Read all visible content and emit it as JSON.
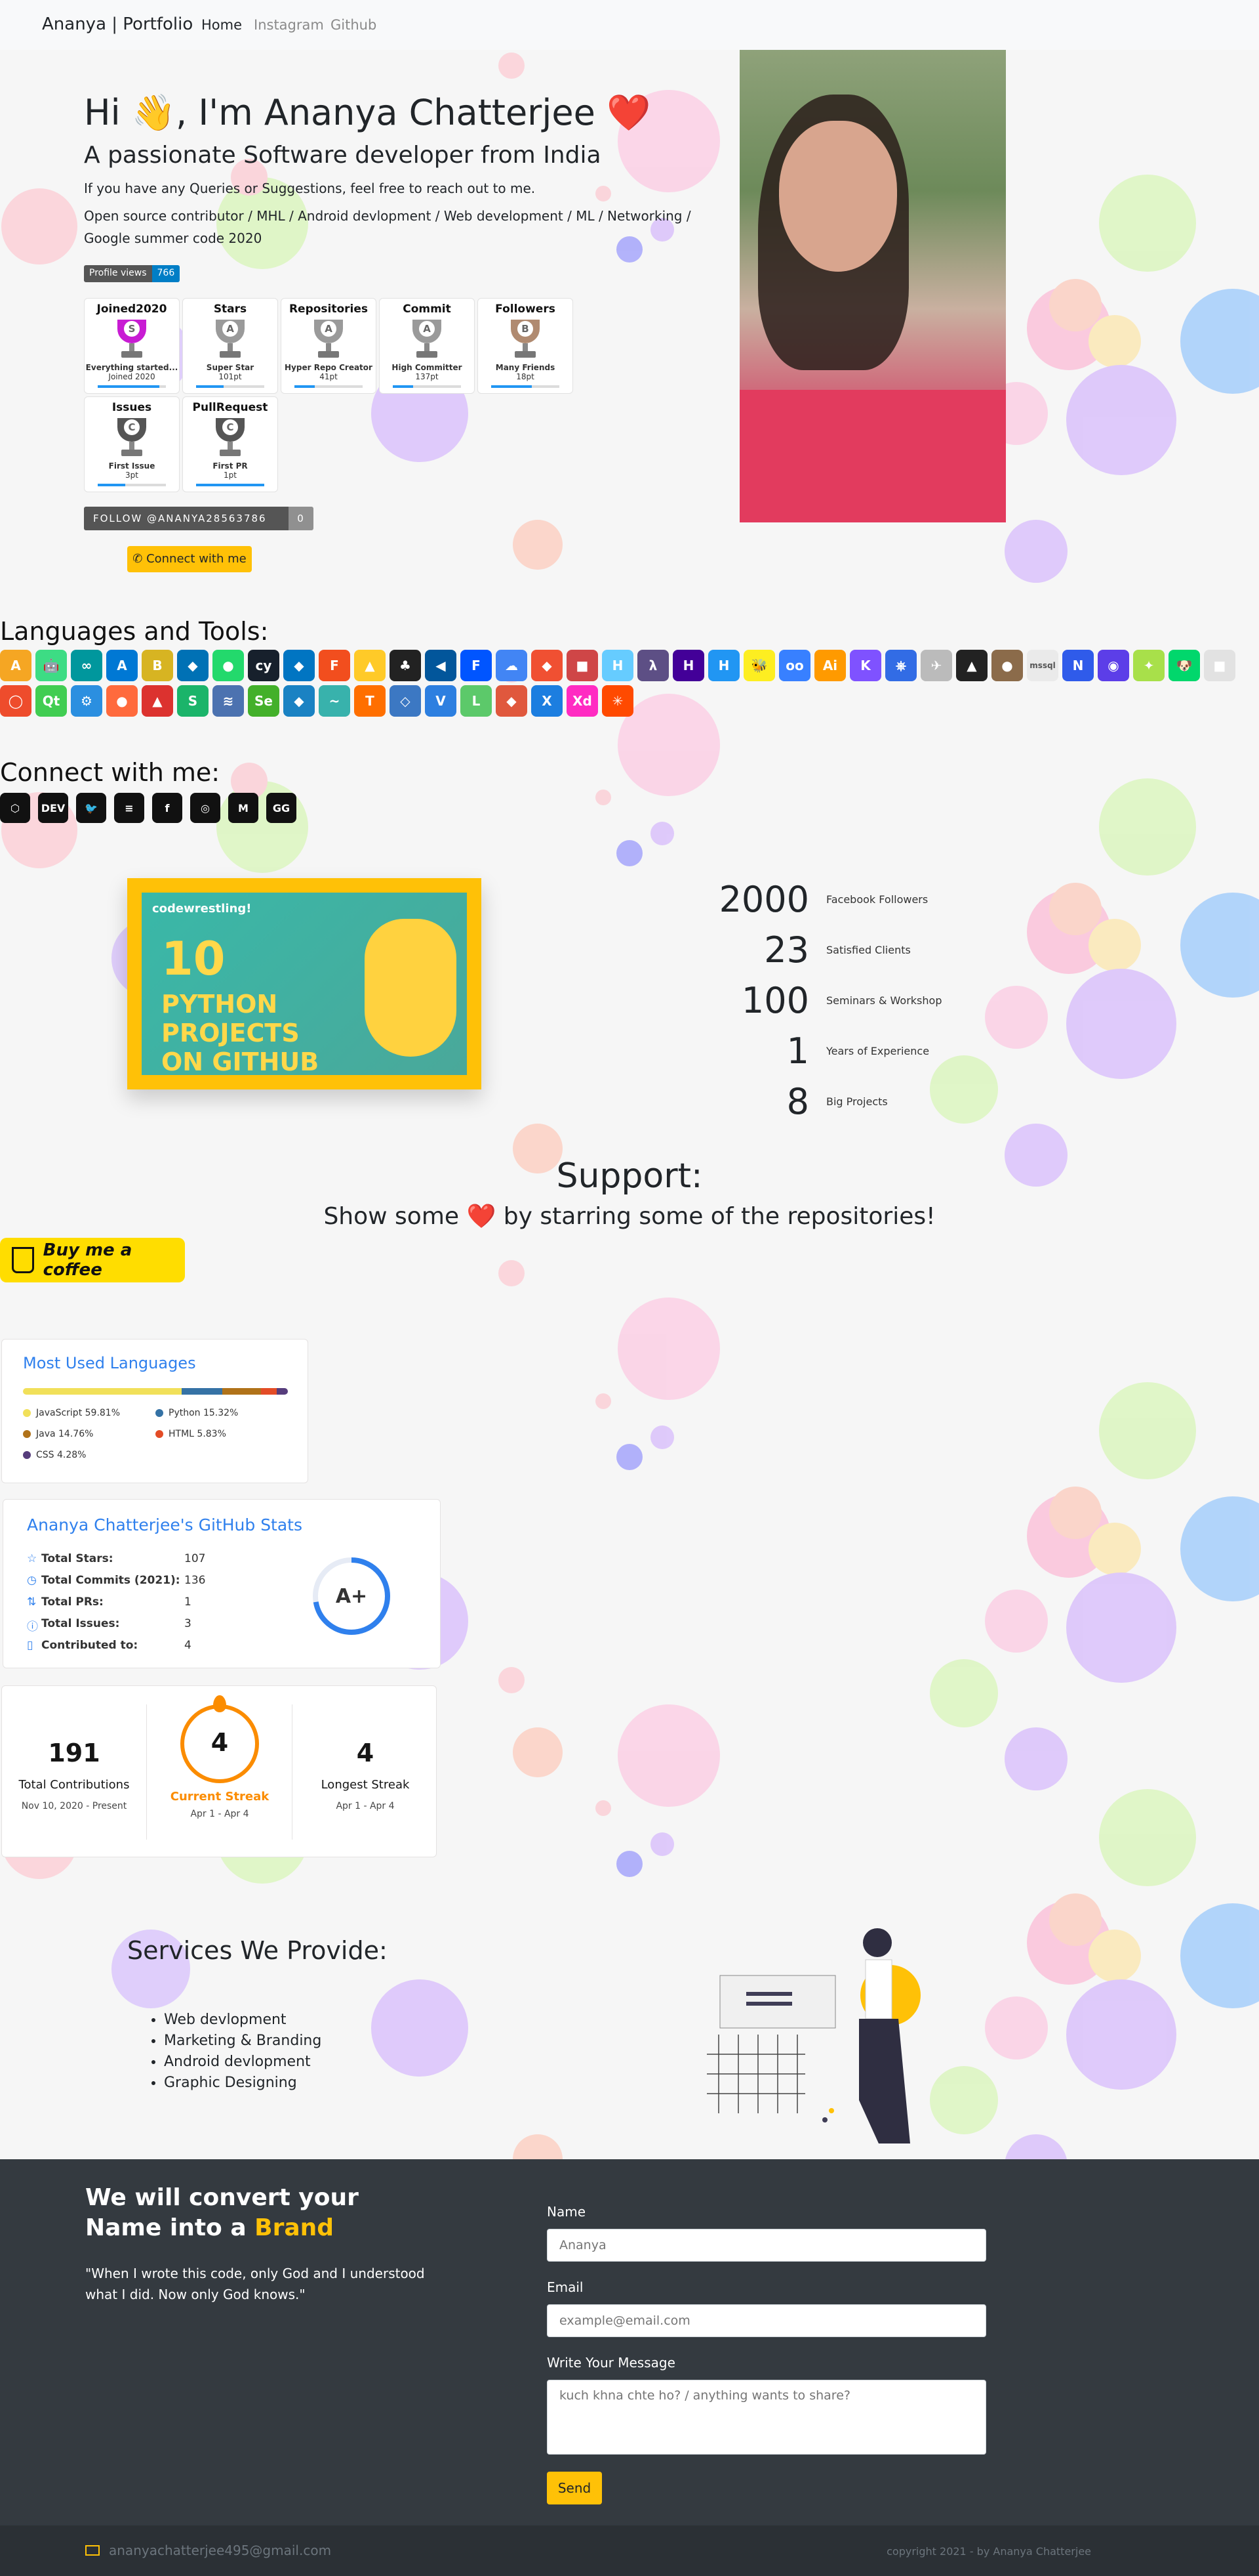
{
  "nav": {
    "brand": "Ananya | Portfolio",
    "home": "Home",
    "instagram": "Instagram",
    "github": "Github"
  },
  "hero": {
    "title": "Hi 👋, I'm Ananya Chatterjee ❤️",
    "subtitle": "A passionate Software developer from India",
    "line1": "If you have any Queries or Suggestions, feel free to reach out to me.",
    "line2": "Open source contributor / MHL / Android devlopment / Web development / ML / Networking / Google summer code 2020",
    "profile_views_label": "Profile views",
    "profile_views_value": "766",
    "follow_label": "FOLLOW @ANANYA28563786",
    "follow_count": "0",
    "connect_label": "Connect with me"
  },
  "trophies": [
    {
      "title": "Joined2020",
      "rank": "S",
      "desc1": "Everything started...",
      "desc2": "Joined 2020",
      "fill": 0.9,
      "color": "#c81cd3"
    },
    {
      "title": "Stars",
      "rank": "A",
      "desc1": "Super Star",
      "desc2": "101pt",
      "fill": 0.4,
      "color": "#9a9a9a"
    },
    {
      "title": "Repositories",
      "rank": "A",
      "desc1": "Hyper Repo Creator",
      "desc2": "41pt",
      "fill": 0.3,
      "color": "#9a9a9a"
    },
    {
      "title": "Commit",
      "rank": "A",
      "desc1": "High Committer",
      "desc2": "137pt",
      "fill": 0.3,
      "color": "#9a9a9a"
    },
    {
      "title": "Followers",
      "rank": "B",
      "desc1": "Many Friends",
      "desc2": "18pt",
      "fill": 0.6,
      "color": "#b08a70"
    },
    {
      "title": "Issues",
      "rank": "C",
      "desc1": "First Issue",
      "desc2": "3pt",
      "fill": 0.4,
      "color": "#555555"
    },
    {
      "title": "PullRequest",
      "rank": "C",
      "desc1": "First PR",
      "desc2": "1pt",
      "fill": 1.0,
      "color": "#555555"
    }
  ],
  "languages_heading": "Languages and Tools:",
  "tools": [
    {
      "icon": "angular-icon",
      "glyph": "A",
      "color": "#f5a623"
    },
    {
      "icon": "android-icon",
      "glyph": "🤖",
      "color": "#3ddc84"
    },
    {
      "icon": "arduino-icon",
      "glyph": "∞",
      "color": "#00979d"
    },
    {
      "icon": "azure-icon",
      "glyph": "A",
      "color": "#0078d4"
    },
    {
      "icon": "babel-icon",
      "glyph": "B",
      "color": "#d7b422"
    },
    {
      "icon": "backbone-icon",
      "glyph": "◆",
      "color": "#0071b5"
    },
    {
      "icon": "cucumber-icon",
      "glyph": "●",
      "color": "#23d96c"
    },
    {
      "icon": "cypress-icon",
      "glyph": "cy",
      "color": "#17202c"
    },
    {
      "icon": "dart-icon",
      "glyph": "◆",
      "color": "#0175c2"
    },
    {
      "icon": "figma-icon",
      "glyph": "F",
      "color": "#f24e1e"
    },
    {
      "icon": "firebase-icon",
      "glyph": "▲",
      "color": "#ffca28"
    },
    {
      "icon": "flask-icon",
      "glyph": "♣",
      "color": "#222222"
    },
    {
      "icon": "flutter-icon",
      "glyph": "◀",
      "color": "#02569b"
    },
    {
      "icon": "framer-icon",
      "glyph": "F",
      "color": "#0055ff"
    },
    {
      "icon": "gcloud-icon",
      "glyph": "☁",
      "color": "#4285f4"
    },
    {
      "icon": "git-icon",
      "glyph": "◆",
      "color": "#f05032"
    },
    {
      "icon": "gulp-icon",
      "glyph": "■",
      "color": "#cf4647"
    },
    {
      "icon": "hadoop-icon",
      "glyph": "H",
      "color": "#66ccff"
    },
    {
      "icon": "haskell-icon",
      "glyph": "λ",
      "color": "#5d4f85"
    },
    {
      "icon": "heroku-icon",
      "glyph": "H",
      "color": "#430098"
    },
    {
      "icon": "html-icon",
      "glyph": "H",
      "color": "#2196f3"
    },
    {
      "icon": "hive-icon",
      "glyph": "🐝",
      "color": "#fdee21"
    },
    {
      "icon": "ionic-icon",
      "glyph": "oo",
      "color": "#3880ff"
    },
    {
      "icon": "illustrator-icon",
      "glyph": "Ai",
      "color": "#ff9a00"
    },
    {
      "icon": "kotlin-icon",
      "glyph": "K",
      "color": "#7f52ff"
    },
    {
      "icon": "kubernetes-icon",
      "glyph": "⎈",
      "color": "#326ce5"
    },
    {
      "icon": "kafka-icon",
      "glyph": "✈",
      "color": "#bbbbbb"
    },
    {
      "icon": "mongodb-icon",
      "glyph": "▲",
      "color": "#222222"
    },
    {
      "icon": "ml-icon",
      "glyph": "●",
      "color": "#8b6b4a"
    },
    {
      "icon": "mssql-icon",
      "glyph": "mssql",
      "color": "#eaeaea"
    },
    {
      "icon": "nestjs-icon",
      "glyph": "N",
      "color": "#2f5bea"
    },
    {
      "icon": "opencv-icon",
      "glyph": "◉",
      "color": "#5c3ee8"
    },
    {
      "icon": "pandas-icon",
      "glyph": "✦",
      "color": "#a8e04a"
    },
    {
      "icon": "puppeteer-icon",
      "glyph": "🐶",
      "color": "#01d76c"
    },
    {
      "icon": "postman-icon",
      "glyph": "■",
      "color": "#e2e2e2"
    },
    {
      "icon": "pytorch-icon",
      "glyph": "◯",
      "color": "#ee4c2c"
    },
    {
      "icon": "qt-icon",
      "glyph": "Qt",
      "color": "#41cd52"
    },
    {
      "icon": "redux-icon",
      "glyph": "⚙",
      "color": "#2b8fe0"
    },
    {
      "icon": "solidity-icon",
      "glyph": "●",
      "color": "#ff6a3d"
    },
    {
      "icon": "scala-icon",
      "glyph": "▲",
      "color": "#dc322f"
    },
    {
      "icon": "sass-icon",
      "glyph": "S",
      "color": "#1bb46a"
    },
    {
      "icon": "seaborn-icon",
      "glyph": "≋",
      "color": "#4c72b0"
    },
    {
      "icon": "selenium-icon",
      "glyph": "Se",
      "color": "#43b02a"
    },
    {
      "icon": "sketch-icon",
      "glyph": "◆",
      "color": "#1a82c3"
    },
    {
      "icon": "tailwind-icon",
      "glyph": "~",
      "color": "#38b2ac"
    },
    {
      "icon": "tensorflow-icon",
      "glyph": "T",
      "color": "#ff6f00"
    },
    {
      "icon": "unity-icon",
      "glyph": "◇",
      "color": "#3c78c3"
    },
    {
      "icon": "vuejs-icon",
      "glyph": "V",
      "color": "#2d7fe0"
    },
    {
      "icon": "visualbasic-icon",
      "glyph": "L",
      "color": "#5cc96a"
    },
    {
      "icon": "xamarin-icon",
      "glyph": "◆",
      "color": "#e0583d"
    },
    {
      "icon": "xcode-icon",
      "glyph": "X",
      "color": "#1c7ee0"
    },
    {
      "icon": "xd-icon",
      "glyph": "Xd",
      "color": "#ff2bc2"
    },
    {
      "icon": "zapier-icon",
      "glyph": "✳",
      "color": "#ff4a00"
    }
  ],
  "connect_heading": "Connect with me:",
  "social": [
    {
      "icon": "codepen-icon",
      "glyph": "⬡"
    },
    {
      "icon": "dev-icon",
      "glyph": "DEV"
    },
    {
      "icon": "twitter-icon",
      "glyph": "🐦"
    },
    {
      "icon": "stackoverflow-icon",
      "glyph": "≡"
    },
    {
      "icon": "facebook-icon",
      "glyph": "f"
    },
    {
      "icon": "instagram-icon",
      "glyph": "◎"
    },
    {
      "icon": "medium-icon",
      "glyph": "M"
    },
    {
      "icon": "geeksforgeeks-icon",
      "glyph": "GG"
    }
  ],
  "pycard": {
    "tag": "codewrestling!",
    "number": "10",
    "line1": "PYTHON",
    "line2": "PROJECTS",
    "line3": "ON GITHUB"
  },
  "stats": [
    {
      "value": "2000",
      "label": "Facebook Followers"
    },
    {
      "value": "23",
      "label": "Satisfied Clients"
    },
    {
      "value": "100",
      "label": "Seminars & Workshop"
    },
    {
      "value": "1",
      "label": "Years of Experience"
    },
    {
      "value": "8",
      "label": "Big Projects"
    }
  ],
  "support": {
    "heading": "Support:",
    "sub": "Show some ❤️ by starring some of the repositories!",
    "coffee": "Buy me a coffee"
  },
  "lang_card": {
    "title": "Most Used Languages",
    "langs": [
      {
        "name": "JavaScript 59.81%",
        "pct": 59.81,
        "color": "#f1e05a"
      },
      {
        "name": "Python 15.32%",
        "pct": 15.32,
        "color": "#3572a5"
      },
      {
        "name": "Java 14.76%",
        "pct": 14.76,
        "color": "#b07219"
      },
      {
        "name": "HTML 5.83%",
        "pct": 5.83,
        "color": "#e34c26"
      },
      {
        "name": "CSS 4.28%",
        "pct": 4.28,
        "color": "#563d7c"
      }
    ]
  },
  "gh_card": {
    "title": "Ananya Chatterjee's GitHub Stats",
    "rows": [
      {
        "icon": "star-icon",
        "glyph": "☆",
        "label": "Total Stars:",
        "value": "107"
      },
      {
        "icon": "clock-icon",
        "glyph": "◷",
        "label": "Total Commits (2021):",
        "value": "136"
      },
      {
        "icon": "pr-icon",
        "glyph": "⇅",
        "label": "Total PRs:",
        "value": "1"
      },
      {
        "icon": "issue-icon",
        "glyph": "ⓘ",
        "label": "Total Issues:",
        "value": "3"
      },
      {
        "icon": "repo-icon",
        "glyph": "▯",
        "label": "Contributed to:",
        "value": "4"
      }
    ],
    "grade": "A+"
  },
  "streak": {
    "total": "191",
    "total_label": "Total Contributions",
    "total_range": "Nov 10, 2020 - Present",
    "current": "4",
    "current_label": "Current Streak",
    "current_range": "Apr 1 - Apr 4",
    "longest": "4",
    "longest_label": "Longest Streak",
    "longest_range": "Apr 1 - Apr 4"
  },
  "services": {
    "heading": "Services We Provide:",
    "items": [
      "Web devlopment",
      "Marketing & Branding",
      "Android devlopment",
      "Graphic Designing"
    ]
  },
  "contact": {
    "heading_pre": "We will convert your Name into a",
    "heading_brand": "Brand",
    "quote": "\"When I wrote this code, only God and I understood what I did. Now only God knows.\"",
    "name_label": "Name",
    "name_placeholder": "Ananya",
    "email_label": "Email",
    "email_placeholder": "example@email.com",
    "message_label": "Write Your Message",
    "message_placeholder": "kuch khna chte ho? / anything wants to share?",
    "send": "Send"
  },
  "footer": {
    "email": "ananyachatterjee495@gmail.com",
    "copyright": "copyright 2021 - by Ananya Chatterjee"
  }
}
